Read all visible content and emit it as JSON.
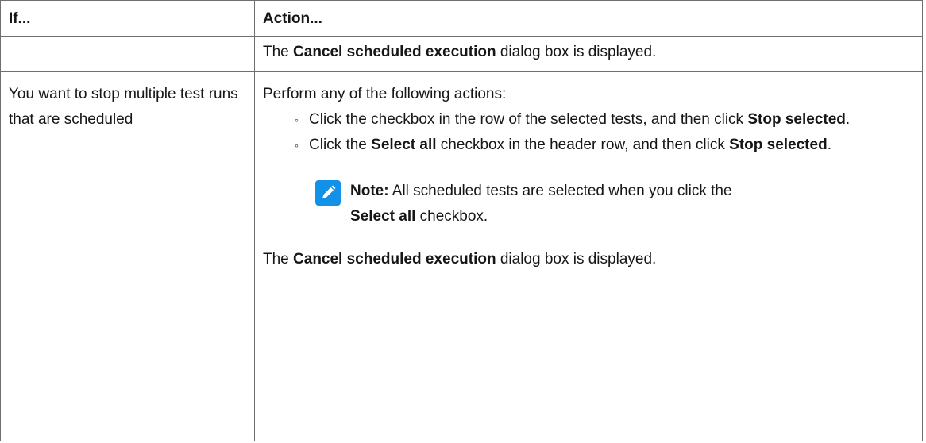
{
  "table": {
    "header_if": "If...",
    "header_action": "Action...",
    "row1": {
      "action_prefix": "The ",
      "action_bold": "Cancel scheduled execution",
      "action_suffix": " dialog box is displayed."
    },
    "row2": {
      "condition": "You want to stop multiple test runs that are scheduled",
      "intro": "Perform any of the following actions:",
      "option1": {
        "text": "Click the checkbox in the row of the selected tests, and then click ",
        "bold": "Stop selected",
        "end": "."
      },
      "option2": {
        "pre": "Click the ",
        "bold1": "Select all",
        "mid": " checkbox in the header row, and then click ",
        "bold2": "Stop selected",
        "end": "."
      },
      "note": {
        "label": "Note:",
        "text": " All scheduled tests are selected when you click the ",
        "bold": "Select all",
        "end": " checkbox."
      },
      "final_prefix": "The ",
      "final_bold": "Cancel scheduled execution",
      "final_suffix": " dialog box is displayed."
    }
  },
  "colors": {
    "note_icon_bg": "#1192e8",
    "border": "#6f6f6f"
  },
  "icons": {
    "note": "pencil-note-icon"
  }
}
